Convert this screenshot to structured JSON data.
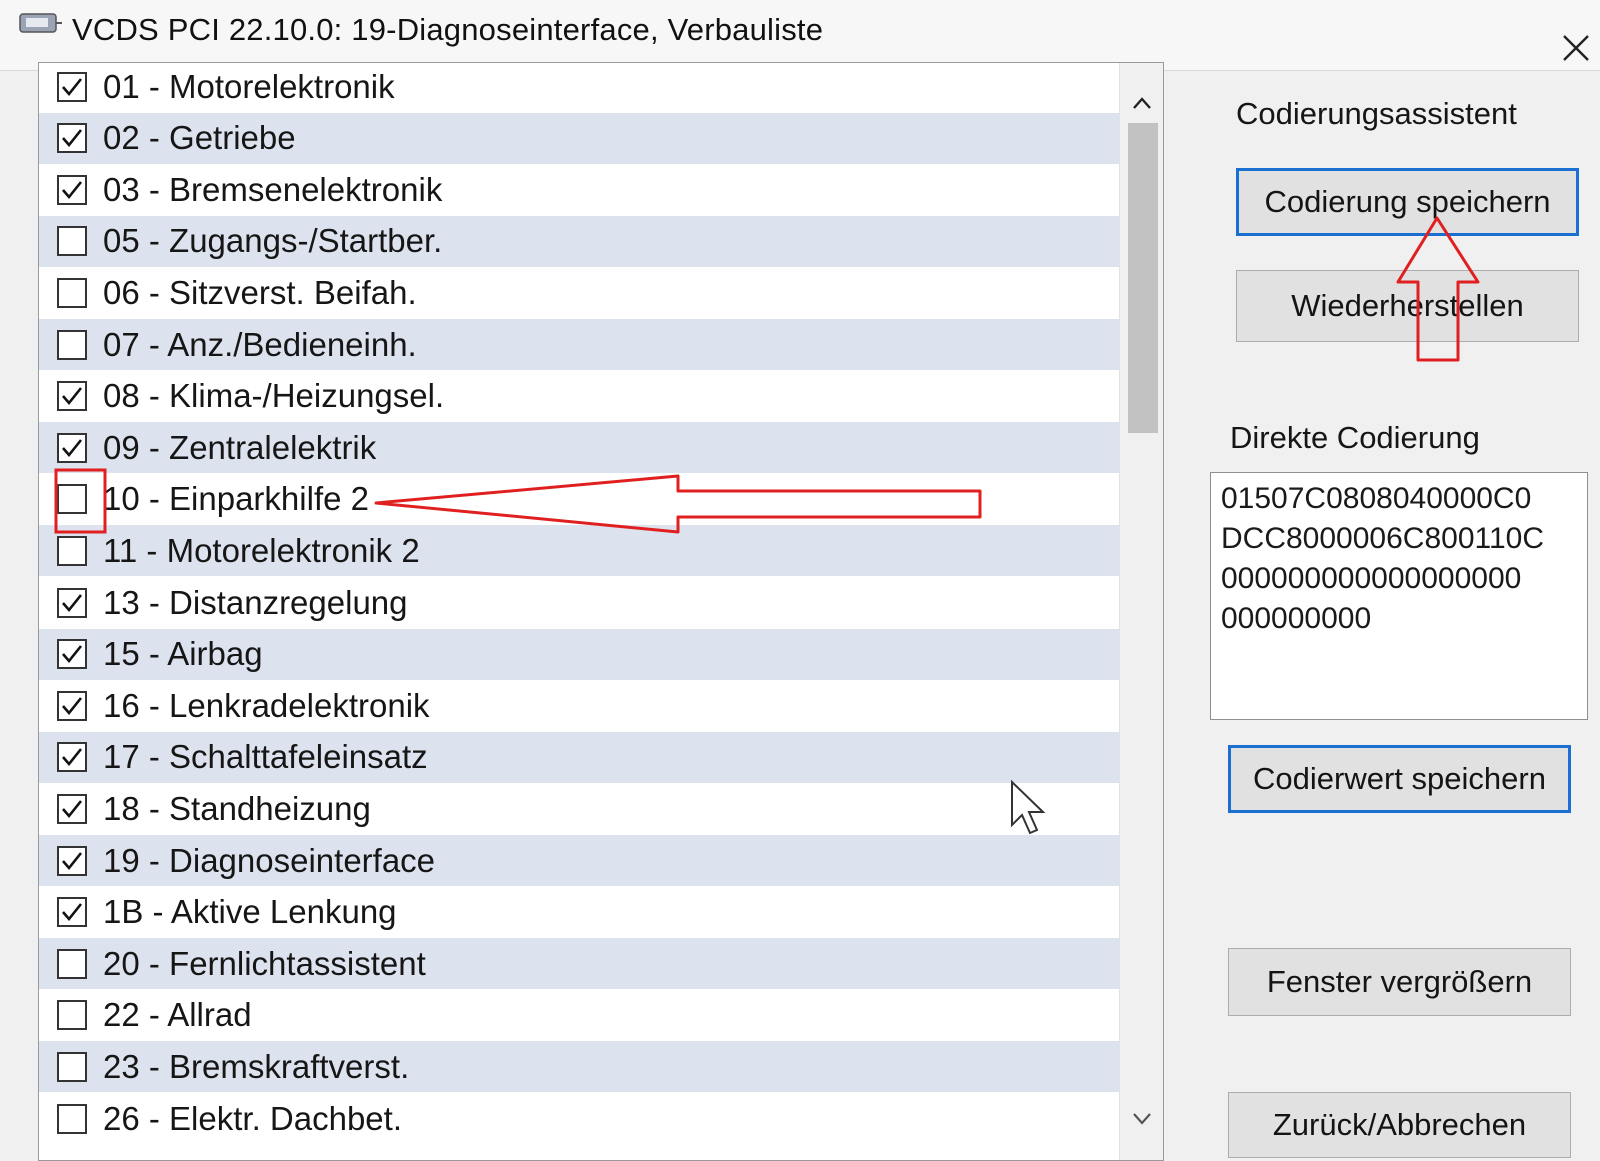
{
  "window": {
    "title": "VCDS PCI 22.10.0: 19-Diagnoseinterface,  Verbauliste",
    "close_symbol": "✕"
  },
  "module_list": [
    {
      "label": "01 - Motorelektronik",
      "checked": true
    },
    {
      "label": "02 - Getriebe",
      "checked": true
    },
    {
      "label": "03 - Bremsenelektronik",
      "checked": true
    },
    {
      "label": "05 - Zugangs-/Startber.",
      "checked": false
    },
    {
      "label": "06 - Sitzverst. Beifah.",
      "checked": false
    },
    {
      "label": "07 - Anz./Bedieneinh.",
      "checked": false
    },
    {
      "label": "08 - Klima-/Heizungsel.",
      "checked": true
    },
    {
      "label": "09 - Zentralelektrik",
      "checked": true
    },
    {
      "label": "10 - Einparkhilfe 2",
      "checked": false
    },
    {
      "label": "11 - Motorelektronik 2",
      "checked": false
    },
    {
      "label": "13 - Distanzregelung",
      "checked": true
    },
    {
      "label": "15 - Airbag",
      "checked": true
    },
    {
      "label": "16 - Lenkradelektronik",
      "checked": true
    },
    {
      "label": "17 - Schalttafeleinsatz",
      "checked": true
    },
    {
      "label": "18 - Standheizung",
      "checked": true
    },
    {
      "label": "19 - Diagnoseinterface",
      "checked": true
    },
    {
      "label": "1B - Aktive Lenkung",
      "checked": true
    },
    {
      "label": "20 - Fernlichtassistent",
      "checked": false
    },
    {
      "label": "22 - Allrad",
      "checked": false
    },
    {
      "label": "23 - Bremskraftverst.",
      "checked": false
    },
    {
      "label": "26 - Elektr. Dachbet.",
      "checked": false
    }
  ],
  "assistant": {
    "heading": "Codierungsassistent",
    "save_label": "Codierung speichern",
    "restore_label": "Wiederherstellen"
  },
  "direct_coding": {
    "heading": "Direkte Codierung",
    "lines": [
      "01507C0808040000C0",
      "DCC8000006C800110C",
      "000000000000000000",
      "000000000"
    ],
    "save_label": "Codierwert speichern"
  },
  "footer_buttons": {
    "enlarge_label": "Fenster vergrößern",
    "back_label": "Zurück/Abbrechen"
  },
  "annotation_color": "#e02020"
}
